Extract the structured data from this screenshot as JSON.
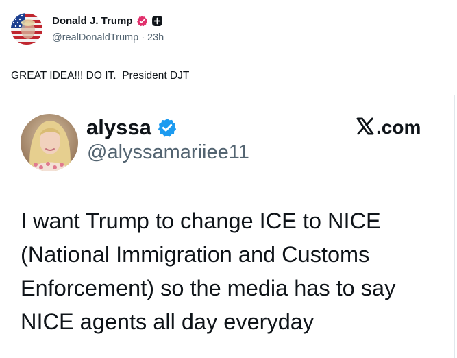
{
  "post": {
    "author": {
      "display_name": "Donald J. Trump",
      "handle": "@realDonaldTrump",
      "separator": "·",
      "time": "23h",
      "avatar_icon": "american-flag-portrait",
      "badges": [
        "verified-badge-icon",
        "plus-badge-icon"
      ]
    },
    "text": "GREAT IDEA!!! DO IT.  President DJT"
  },
  "quoted": {
    "author": {
      "display_name": "alyssa",
      "handle": "@alyssamariiee11",
      "avatar_icon": "profile-photo",
      "verified_icon": "blue-verified-icon"
    },
    "brand": {
      "text": ".com",
      "logo_icon": "x-logo-icon"
    },
    "body": "I want Trump to change ICE to NICE (National Immigration and Customs Enforcement) so the media has to say NICE agents all day everyday"
  },
  "colors": {
    "text": "#0f1419",
    "secondary": "#536471",
    "verified_pink": "#e1306c",
    "verified_blue": "#1d9bf0"
  }
}
